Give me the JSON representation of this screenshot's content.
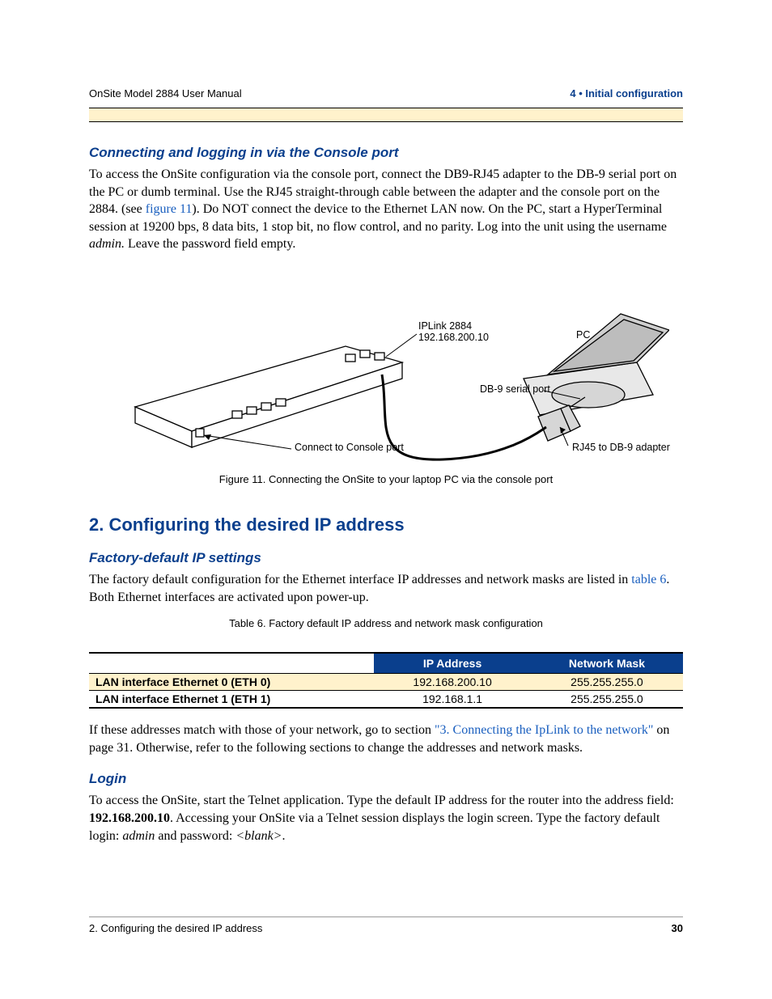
{
  "header": {
    "left": "OnSite Model 2884 User Manual",
    "right": "4 • Initial configuration"
  },
  "s1": {
    "title": "Connecting and logging in via the Console port",
    "para_a": "To access the OnSite configuration via the console port, connect the DB9-RJ45 adapter to the DB-9 serial port on the PC or dumb terminal. Use the RJ45 straight-through cable between the adapter and the console port on the 2884. (see ",
    "link1": "figure 11",
    "para_b": "). Do NOT connect the device to the Ethernet LAN now. On the PC, start a HyperTerminal session at 19200 bps, 8 data bits, 1 stop bit, no flow control, and no parity. Log into the unit using the username ",
    "admin": "admin.",
    "para_c": " Leave the password field empty."
  },
  "diagram": {
    "device_name": "IPLink 2884",
    "device_ip": "192.168.200.10",
    "pc": "PC",
    "db9": "DB-9 serial port",
    "adapter": "RJ45 to DB-9 adapter",
    "consoleport": "Connect to Console port"
  },
  "figcap": "Figure 11. Connecting the OnSite to your laptop PC via the console port",
  "h2": "2. Configuring the desired IP address",
  "s2": {
    "title": "Factory-default IP settings",
    "para_a": "The factory default configuration for the Ethernet interface IP addresses and network masks are listed in ",
    "link": "table 6",
    "para_b": ". Both Ethernet interfaces are activated upon power-up."
  },
  "tablecap": "Table 6. Factory default IP address and network mask configuration",
  "table": {
    "col_ip": "IP Address",
    "col_mask": "Network Mask",
    "rows": [
      {
        "label": "LAN interface Ethernet 0 (ETH 0)",
        "ip": "192.168.200.10",
        "mask": "255.255.255.0"
      },
      {
        "label": "LAN interface Ethernet 1 (ETH 1)",
        "ip": "192.168.1.1",
        "mask": "255.255.255.0"
      }
    ]
  },
  "s3": {
    "para_a": "If these addresses match with those of your network, go to section ",
    "link": "\"3. Connecting the IpLink to the network\"",
    "para_b": " on page 31. Otherwise, refer to the following sections to change the addresses and network masks."
  },
  "s4": {
    "title": "Login",
    "para_a": "To access the OnSite, start the Telnet application. Type the default IP address for the router into the address field: ",
    "ip": "192.168.200.10",
    "para_b": ". Accessing your OnSite via a Telnet session displays the login screen. Type the factory default login: ",
    "admin": "admin",
    "and": " and password: ",
    "blank": "<blank>",
    "dot": "."
  },
  "footer": {
    "left": "2. Configuring the desired IP address",
    "right": "30"
  }
}
